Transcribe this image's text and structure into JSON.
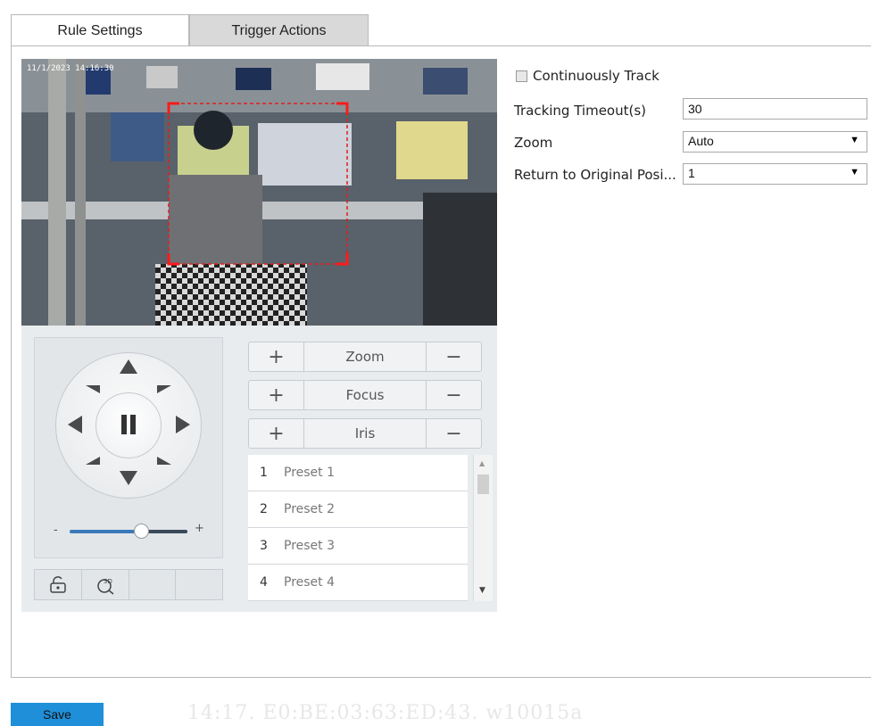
{
  "tabs": {
    "active": "Rule Settings",
    "inactive": "Trigger Actions"
  },
  "video": {
    "osd_text": "11/1/2023 14:16:30"
  },
  "ptz": {
    "minus_label": "-",
    "plus_label": "+",
    "zoom_label": "Zoom",
    "focus_label": "Focus",
    "iris_label": "Iris",
    "pause_icon": "pause-icon",
    "lock_icon": "lock-icon",
    "3d_icon": "3d-positioning-icon"
  },
  "presets": [
    {
      "num": "1",
      "name": "Preset 1"
    },
    {
      "num": "2",
      "name": "Preset 2"
    },
    {
      "num": "3",
      "name": "Preset 3"
    },
    {
      "num": "4",
      "name": "Preset 4"
    }
  ],
  "form": {
    "continuous_track_label": "Continuously Track",
    "continuous_track_checked": false,
    "tracking_timeout_label": "Tracking Timeout(s)",
    "tracking_timeout_value": "30",
    "zoom_label": "Zoom",
    "zoom_value": "Auto",
    "return_label": "Return to Original Posi...",
    "return_value": "1"
  },
  "footer": {
    "save_label": "Save",
    "watermark": "14:17. E0:BE:03:63:ED:43. w10015a"
  },
  "colors": {
    "save_button": "#1f8fd9",
    "slider_fill": "#3a79b8",
    "tracking_box": "#e02020"
  }
}
